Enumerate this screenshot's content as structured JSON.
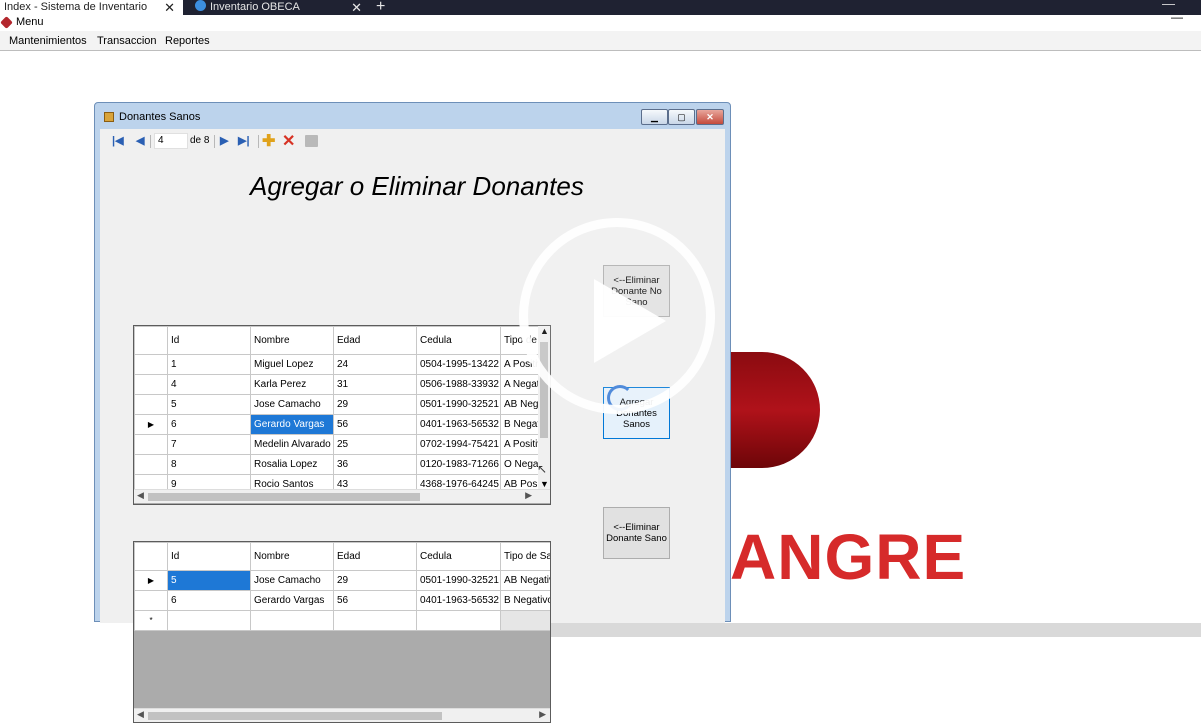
{
  "browser": {
    "tabs": [
      {
        "label": "Index - Sistema de Inventario"
      },
      {
        "label": "Inventario OBECA"
      }
    ]
  },
  "app": {
    "menu_title": "Menu",
    "menu_items": [
      "Mantenimientos",
      "Transaccion",
      "Reportes"
    ]
  },
  "background": {
    "bigtext": "ANGRE"
  },
  "form": {
    "title": "Donantes Sanos",
    "navigator": {
      "position": "4",
      "of_label": "de 8"
    },
    "heading": "Agregar o Eliminar Donantes",
    "columns": [
      "Id",
      "Nombre",
      "Edad",
      "Cedula",
      "Tipo de Sangre"
    ],
    "grid1_rows": [
      {
        "id": "1",
        "nombre": "Miguel Lopez",
        "edad": "24",
        "cedula": "0504-1995-13422",
        "tipo": "A Positivo"
      },
      {
        "id": "4",
        "nombre": "Karla Perez",
        "edad": "31",
        "cedula": "0506-1988-33932",
        "tipo": "A Negativo"
      },
      {
        "id": "5",
        "nombre": "Jose Camacho",
        "edad": "29",
        "cedula": "0501-1990-32521",
        "tipo": "AB Negativo"
      },
      {
        "id": "6",
        "nombre": "Gerardo Vargas",
        "edad": "56",
        "cedula": "0401-1963-56532",
        "tipo": "B Negativo"
      },
      {
        "id": "7",
        "nombre": "Medelin Alvarado",
        "edad": "25",
        "cedula": "0702-1994-75421",
        "tipo": "A Positivo"
      },
      {
        "id": "8",
        "nombre": "Rosalia Lopez",
        "edad": "36",
        "cedula": "0120-1983-71266",
        "tipo": "O Negativo"
      },
      {
        "id": "9",
        "nombre": "Rocio Santos",
        "edad": "43",
        "cedula": "4368-1976-64245",
        "tipo": "AB Positivo"
      }
    ],
    "grid2_rows": [
      {
        "id": "5",
        "nombre": "Jose Camacho",
        "edad": "29",
        "cedula": "0501-1990-32521",
        "tipo": "AB Negativo"
      },
      {
        "id": "6",
        "nombre": "Gerardo Vargas",
        "edad": "56",
        "cedula": "0401-1963-56532",
        "tipo": "B Negativo"
      }
    ],
    "buttons": {
      "eliminar_no_sano": "<--Eliminar Donante No Sano",
      "agregar_sanos": "Agregar Donantes Sanos",
      "eliminar_sano": "<--Eliminar Donante Sano"
    }
  }
}
